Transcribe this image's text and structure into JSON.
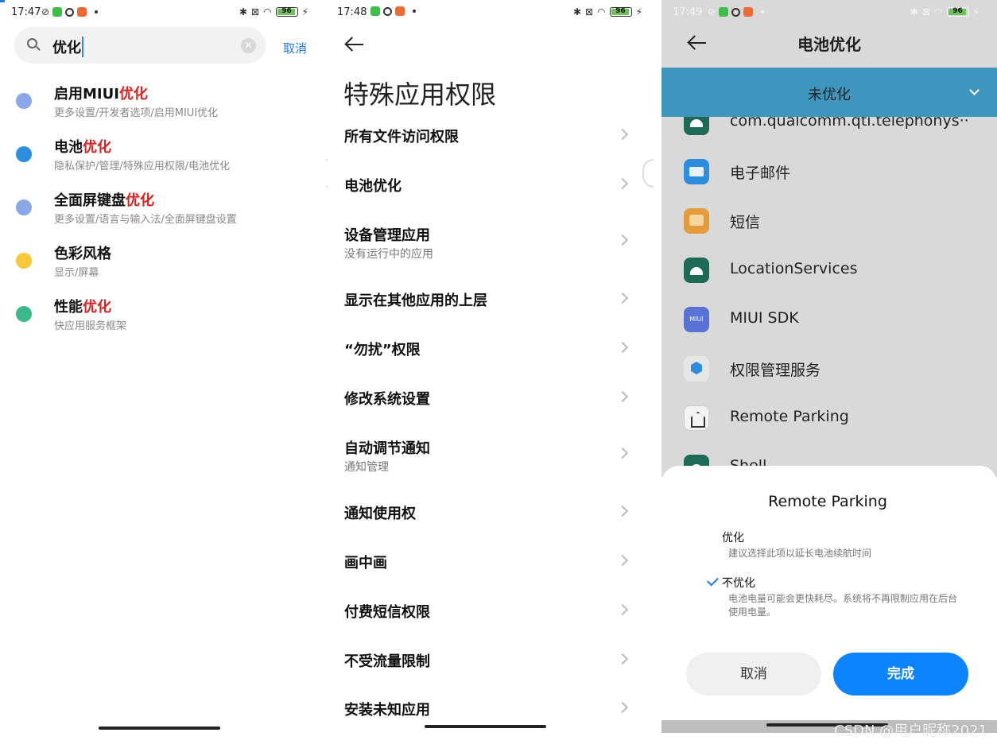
{
  "panel1": {
    "time": "17:47",
    "battery": "96",
    "search_value": "优化",
    "cancel_label": "取消",
    "results": [
      {
        "title_plain": "启用MIUI",
        "title_highlight": "优化",
        "path": "更多设置/开发者选项/启用MIUI优化",
        "icon": "more-dots-icon",
        "color": "#8aa7e8"
      },
      {
        "title_plain": "电池",
        "title_highlight": "优化",
        "path": "隐私保护/管理/特殊应用权限/电池优化",
        "icon": "shield-icon",
        "color": "#2d8ee0"
      },
      {
        "title_plain": "全面屏键盘",
        "title_highlight": "优化",
        "path": "更多设置/语言与输入法/全面屏键盘设置",
        "icon": "more-dots-icon",
        "color": "#8aa7e8"
      },
      {
        "title_plain": "色彩风格",
        "title_highlight": "",
        "path": "显示/屏幕",
        "icon": "sun-icon",
        "color": "#f6c83a"
      },
      {
        "title_plain": "性能",
        "title_highlight": "优化",
        "path": "快应用服务框架",
        "icon": "paper-plane-icon",
        "color": "#3cb88a"
      }
    ]
  },
  "panel2": {
    "time": "17:48",
    "battery": "96",
    "title": "特殊应用权限",
    "rows": [
      {
        "title": "所有文件访问权限",
        "sub": ""
      },
      {
        "title": "电池优化",
        "sub": ""
      },
      {
        "title": "设备管理应用",
        "sub": "没有运行中的应用"
      },
      {
        "title": "显示在其他应用的上层",
        "sub": ""
      },
      {
        "title": "“勿扰”权限",
        "sub": ""
      },
      {
        "title": "修改系统设置",
        "sub": ""
      },
      {
        "title": "自动调节通知",
        "sub": "通知管理"
      },
      {
        "title": "通知使用权",
        "sub": ""
      },
      {
        "title": "画中画",
        "sub": ""
      },
      {
        "title": "付费短信权限",
        "sub": ""
      },
      {
        "title": "不受流量限制",
        "sub": ""
      },
      {
        "title": "安装未知应用",
        "sub": ""
      }
    ]
  },
  "panel3": {
    "time": "17:49",
    "battery": "96",
    "title": "电池优化",
    "filter_label": "未优化",
    "apps": [
      {
        "name": "com.qualcomm.qti.telephonys··",
        "icon": "android-icon"
      },
      {
        "name": "电子邮件",
        "icon": "mail-icon"
      },
      {
        "name": "短信",
        "icon": "sms-icon"
      },
      {
        "name": "LocationServices",
        "icon": "android-icon"
      },
      {
        "name": "MIUI SDK",
        "icon": "miui-icon"
      },
      {
        "name": "权限管理服务",
        "icon": "permission-shield-icon"
      },
      {
        "name": "Remote Parking",
        "icon": "remote-parking-icon"
      },
      {
        "name": "Shell",
        "icon": "android-icon"
      }
    ],
    "miui_icon_text": "MIUI",
    "dialog": {
      "title": "Remote Parking",
      "opt1_title": "优化",
      "opt1_desc": "建议选择此项以延长电池续航时间",
      "opt2_title": "不优化",
      "opt2_desc": "电池电量可能会更快耗尽。系统将不再限制应用在后台使用电量。",
      "cancel": "取消",
      "ok": "完成"
    },
    "watermark": "CSDN @用户昵称2021"
  }
}
